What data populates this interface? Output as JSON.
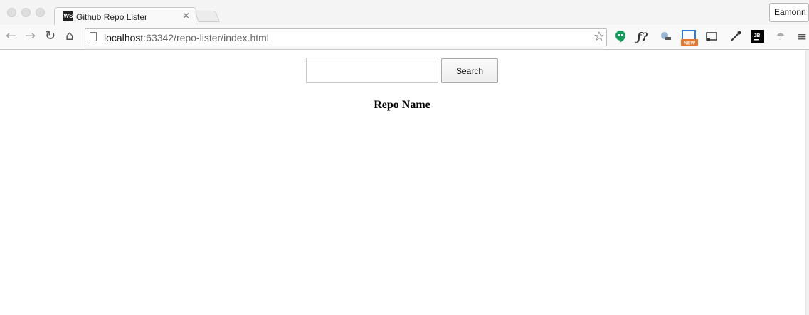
{
  "browser": {
    "tab_title": "Github Repo Lister",
    "tab_favicon_text": "WS",
    "tab_close": "×",
    "profile_name": "Eamonn",
    "url_host": "localhost",
    "url_path": ":63342/repo-lister/index.html",
    "extensions": [
      "hangouts-icon",
      "function-help-icon",
      "satellite-icon",
      "screenshot-new-icon",
      "cast-icon",
      "eyedropper-icon",
      "jetbrains-icon",
      "palm-tree-icon",
      "menu-icon"
    ]
  },
  "page": {
    "search_value": "",
    "search_button_label": "Search",
    "column_header": "Repo Name"
  },
  "colors": {
    "hangouts_green": "#0F9D58",
    "new_badge_orange": "#E8772E"
  }
}
